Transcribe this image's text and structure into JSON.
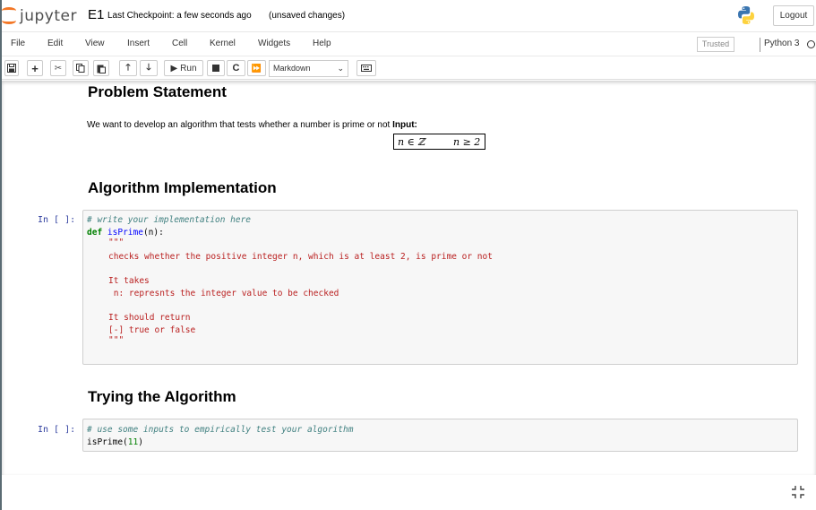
{
  "header": {
    "logo_text": "jupyter",
    "notebook_name": "E1",
    "checkpoint": "Last Checkpoint: a few seconds ago",
    "unsaved": "(unsaved changes)",
    "logout_label": "Logout"
  },
  "menubar": {
    "items": [
      "File",
      "Edit",
      "View",
      "Insert",
      "Cell",
      "Kernel",
      "Widgets",
      "Help"
    ],
    "trusted": "Trusted",
    "kernel": "Python 3"
  },
  "toolbar": {
    "run_label": "Run",
    "cell_type": "Markdown"
  },
  "cells": {
    "problem_heading": "Problem Statement",
    "problem_text": "We want to develop an algorithm that tests whether a number is prime or not ",
    "problem_input_label": "Input:",
    "math_left": "n ∈ ℤ",
    "math_right": "n ≥ 2",
    "impl_heading": "Algorithm Implementation",
    "impl_prompt": "In [ ]:",
    "impl_code": {
      "l1": "# write your implementation here",
      "l2_kw": "def",
      "l2_fn": "isPrime",
      "l2_rest": "(n):",
      "l3": "\"\"\"",
      "l4": "checks whether the positive integer n, which is at least 2, is prime or not",
      "l5": "It takes",
      "l6": " n: represnts the integer value to be checked",
      "l7": "It should return",
      "l8": "[-] true or false",
      "l9": "\"\"\""
    },
    "try_heading": "Trying the Algorithm",
    "try_prompt": "In [ ]:",
    "try_code": {
      "l1": "# use some inputs to empirically test your algorithm",
      "l2_fn": "isPrime(",
      "l2_num": "11",
      "l2_close": ")"
    }
  }
}
